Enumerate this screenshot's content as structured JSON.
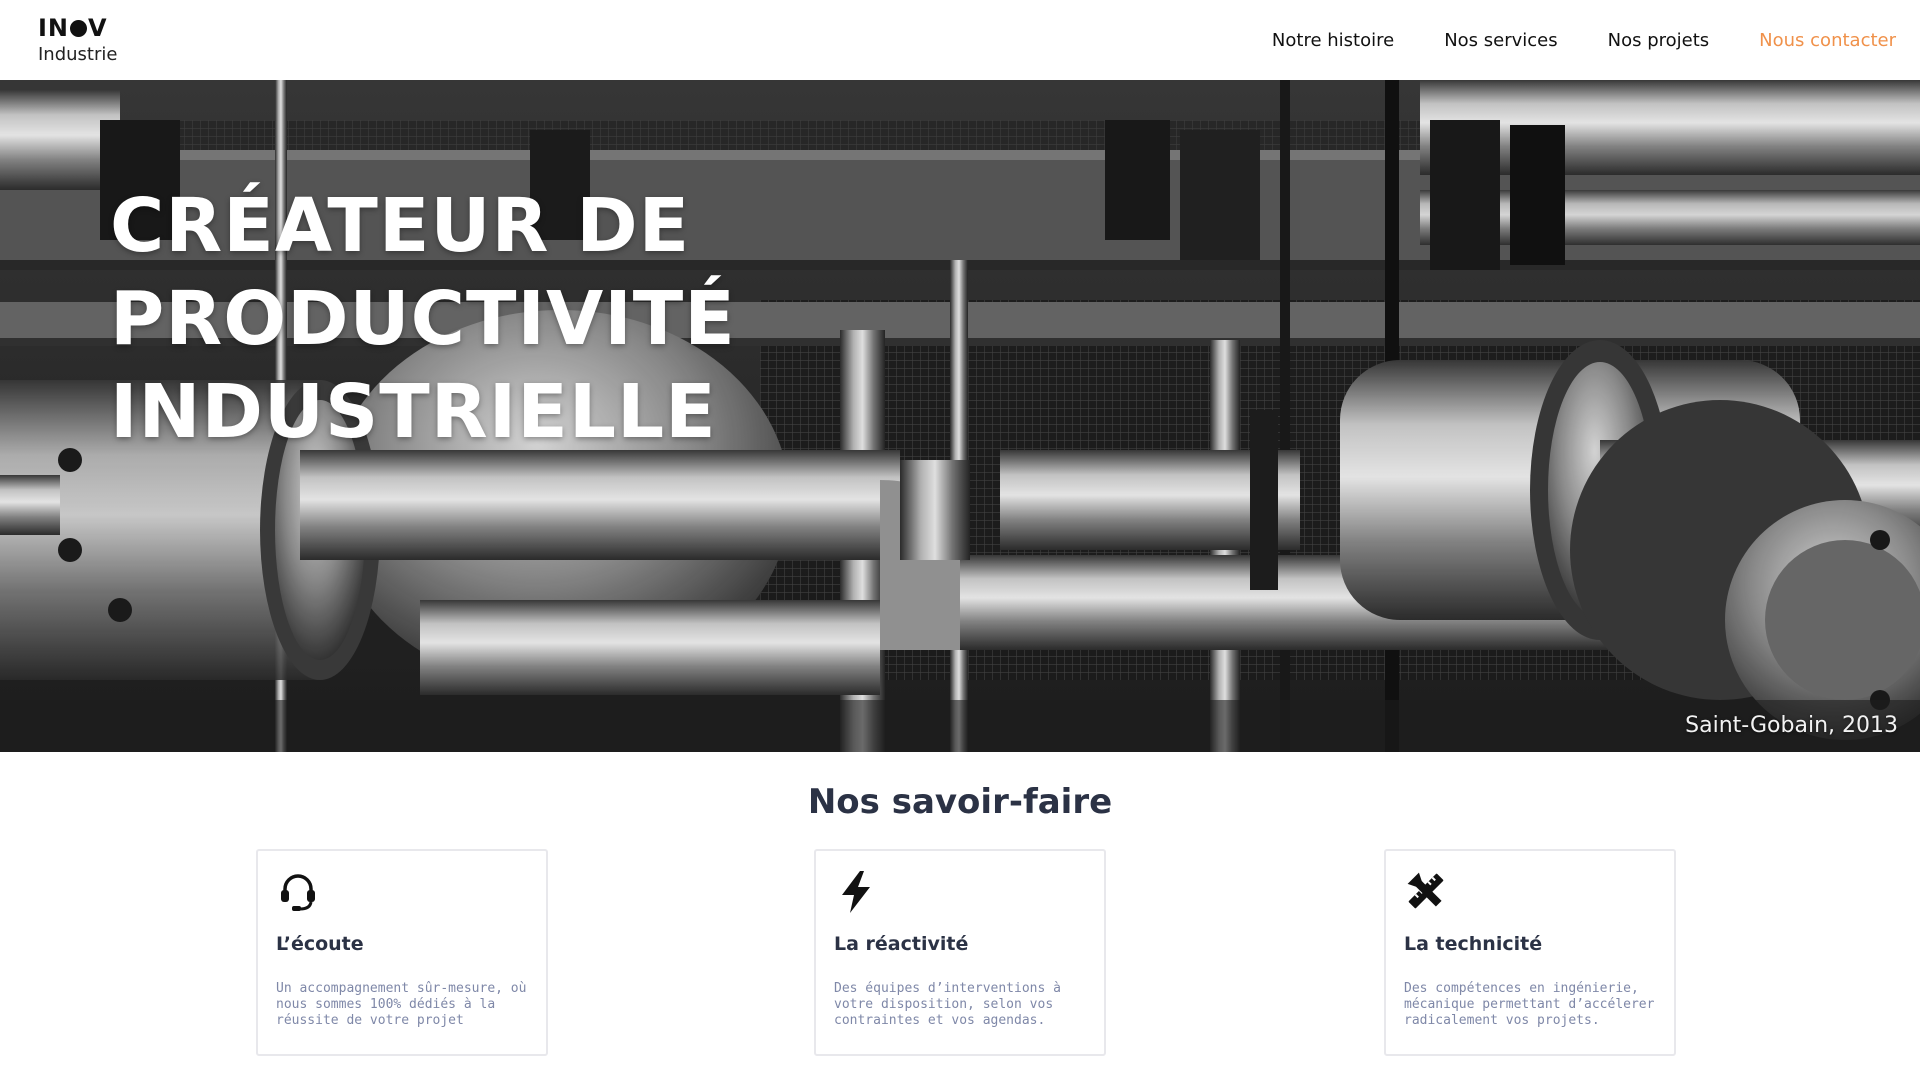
{
  "header": {
    "brand": {
      "name_left": "IN",
      "name_right": "V",
      "subtitle": "Industrie"
    },
    "nav": [
      {
        "label": "Notre histoire"
      },
      {
        "label": "Nos services"
      },
      {
        "label": "Nos projets"
      },
      {
        "label": "Nous contacter",
        "accent": "#f0914a"
      }
    ]
  },
  "hero": {
    "title_lines": [
      "CRÉATEUR DE",
      "PRODUCTIVITÉ",
      "INDUSTRIELLE"
    ],
    "caption": "Saint-Gobain, 2013",
    "image": "black-and-white industrial pipes photo"
  },
  "section": {
    "title": "Nos savoir-faire",
    "cards": [
      {
        "icon": "headset-icon",
        "title": "L’écoute",
        "text": "Un accompagnement sûr-mesure, où nous sommes 100% dédiés à la réussite de votre projet"
      },
      {
        "icon": "lightning-icon",
        "title": "La réactivité",
        "text": "Des équipes d’interventions à votre disposition, selon vos contraintes et vos agendas."
      },
      {
        "icon": "tools-icon",
        "title": "La technicité",
        "text": "Des compétences en ingénierie, mécanique permettant d’accélerer radicalement vos projets."
      }
    ]
  }
}
